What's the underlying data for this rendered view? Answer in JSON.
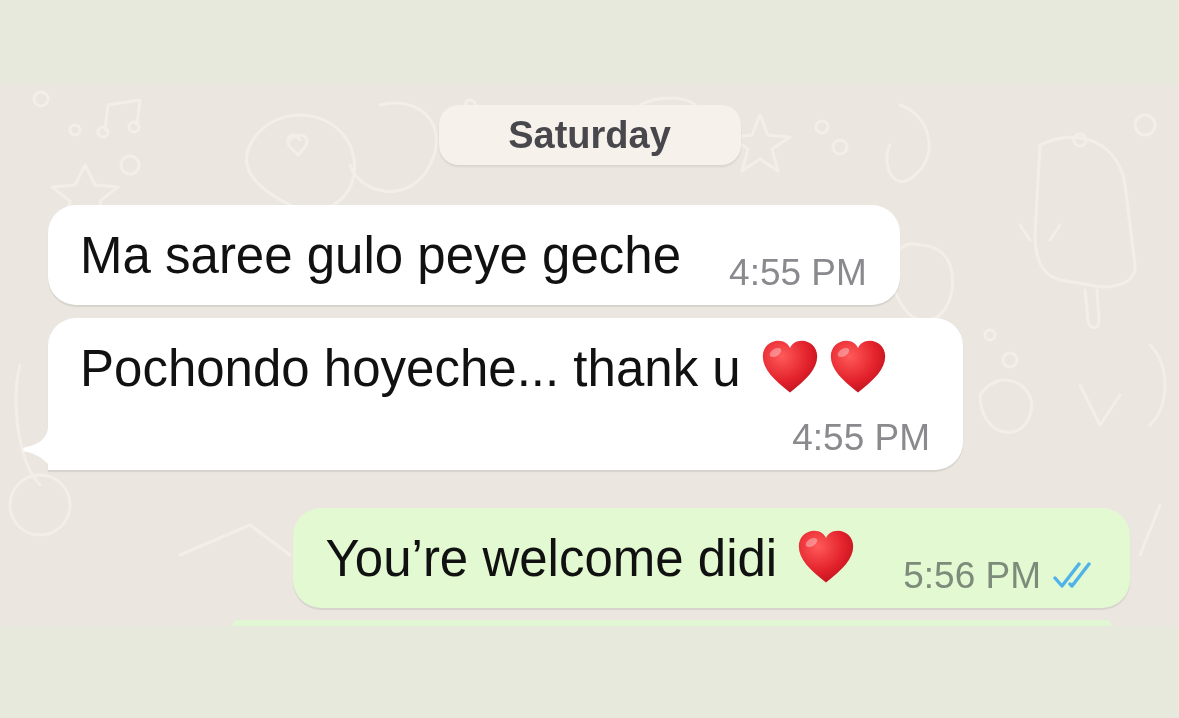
{
  "chat": {
    "date_divider": {
      "label": "Saturday"
    },
    "messages": [
      {
        "kind": "incoming",
        "text": "Ma saree gulo peye geche",
        "time": "4:55 PM",
        "tail": false
      },
      {
        "kind": "incoming",
        "text": "Pochondo hoyeche... thank u",
        "emoji": [
          {
            "kind": "heart"
          },
          {
            "kind": "heart"
          }
        ],
        "time": "4:55 PM",
        "tail": true
      },
      {
        "kind": "outgoing",
        "text": "You’re welcome didi",
        "emoji": [
          {
            "kind": "heart"
          }
        ],
        "time": "5:56 PM",
        "tail": false,
        "read": true
      }
    ]
  }
}
